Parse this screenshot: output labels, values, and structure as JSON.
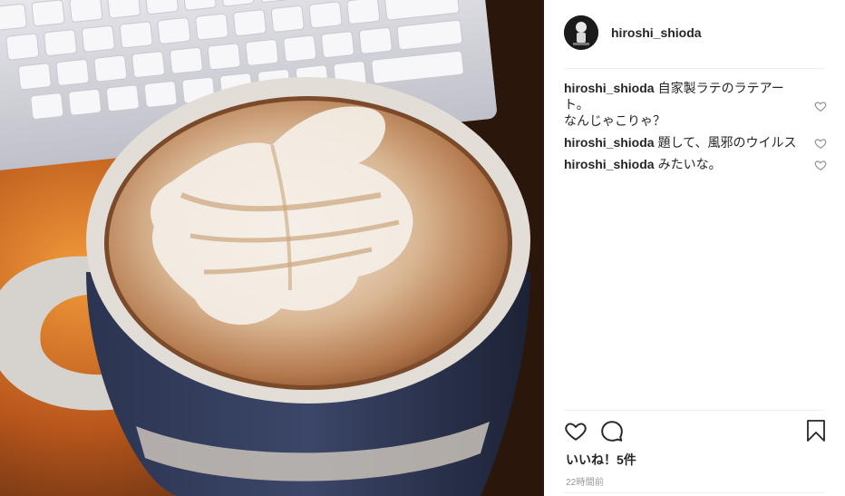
{
  "post": {
    "username": "hiroshi_shioda",
    "comments": [
      {
        "user": "hiroshi_shioda",
        "text": "自家製ラテのラテアート。\nなんじゃこりゃ？"
      },
      {
        "user": "hiroshi_shioda",
        "text": "題して、風邪のウイルス"
      },
      {
        "user": "hiroshi_shioda",
        "text": "みたいな。"
      }
    ],
    "likes_label": "いいね！5件",
    "timestamp": "22時間前"
  },
  "icons": {
    "avatar": "avatar",
    "like": "heart-icon",
    "comment": "comment-bubble-icon",
    "save": "bookmark-icon"
  },
  "colors": {
    "text": "#262626",
    "muted": "#999999",
    "divider": "#efefef"
  }
}
